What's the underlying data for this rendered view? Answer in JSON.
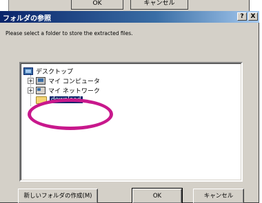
{
  "background_dialog": {
    "ok_label": "OK",
    "cancel_label": "キャンセル"
  },
  "dialog": {
    "title": "フォルダの参照",
    "help_label": "?",
    "close_label": "X",
    "instruction": "Please select a folder to store the extracted files.",
    "tree": {
      "items": [
        {
          "label": "デスクトップ",
          "icon": "desktop-icon"
        },
        {
          "label": "マイ コンピュータ",
          "icon": "computer-icon"
        },
        {
          "label": "マイ ネットワーク",
          "icon": "network-icon"
        },
        {
          "label": "download",
          "icon": "folder-icon",
          "selected": true
        }
      ]
    },
    "buttons": {
      "new_folder": "新しいフォルダの作成(M)",
      "ok": "OK",
      "cancel": "キャンセル"
    }
  },
  "colors": {
    "highlight_ring": "#c8188c",
    "selection": "#0a246a",
    "titlebar": "#0a246a"
  }
}
